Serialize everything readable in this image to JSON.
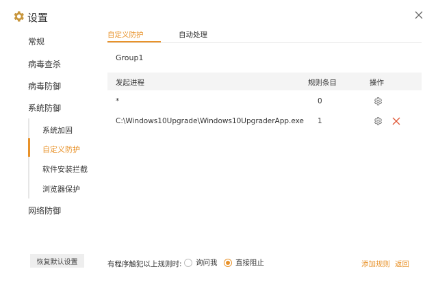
{
  "window": {
    "title": "设置",
    "accent_color": "#e8922a",
    "icons": {
      "app": "gear-icon",
      "close": "close-icon"
    }
  },
  "sidebar": {
    "items": [
      {
        "label": "常规"
      },
      {
        "label": "病毒查杀"
      },
      {
        "label": "病毒防御"
      },
      {
        "label": "系统防御"
      }
    ],
    "subitems": [
      {
        "label": "系统加固",
        "active": false
      },
      {
        "label": "自定义防护",
        "active": true
      },
      {
        "label": "软件安装拦截",
        "active": false
      },
      {
        "label": "浏览器保护",
        "active": false
      }
    ],
    "bottom_item": {
      "label": "网络防御"
    },
    "reset_button": "恢复默认设置"
  },
  "tabs": [
    {
      "label": "自定义防护",
      "active": true
    },
    {
      "label": "自动处理",
      "active": false
    }
  ],
  "group": {
    "name": "Group1"
  },
  "table": {
    "headers": {
      "process": "发起进程",
      "rules": "规则条目",
      "action": "操作"
    },
    "rows": [
      {
        "process": "*",
        "rules": "0",
        "actions": [
          "gear-icon"
        ]
      },
      {
        "process": "C:\\Windows10Upgrade\\Windows10UpgraderApp.exe",
        "rules": "1",
        "actions": [
          "gear-icon",
          "delete-icon"
        ]
      }
    ]
  },
  "footer": {
    "prompt": "有程序触犯以上规则时:",
    "options": [
      {
        "label": "询问我",
        "selected": false
      },
      {
        "label": "直接阻止",
        "selected": true
      }
    ],
    "add_rule": "添加规则",
    "back": "返回"
  }
}
